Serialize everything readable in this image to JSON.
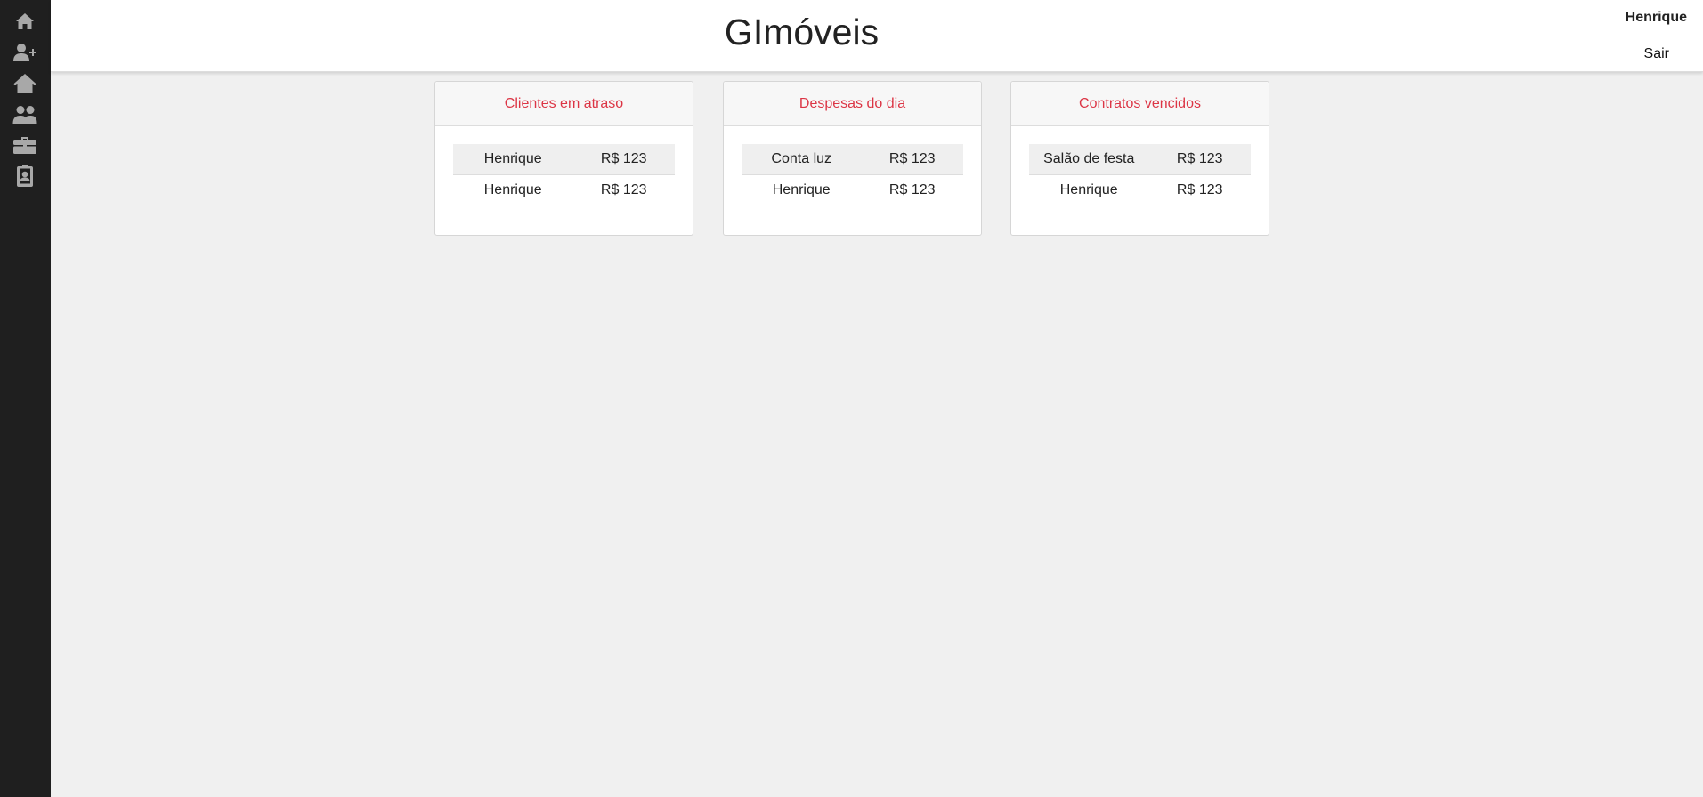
{
  "header": {
    "title": "GImóveis",
    "user": "Henrique",
    "logout_label": "Sair"
  },
  "sidebar": {
    "items": [
      {
        "icon": "home-icon"
      },
      {
        "icon": "add-user-icon"
      },
      {
        "icon": "property-icon"
      },
      {
        "icon": "users-icon"
      },
      {
        "icon": "briefcase-icon"
      },
      {
        "icon": "contact-badge-icon"
      }
    ]
  },
  "cards": [
    {
      "title": "Clientes em atraso",
      "rows": [
        {
          "name": "Henrique",
          "value": "R$ 123"
        },
        {
          "name": "Henrique",
          "value": "R$ 123"
        }
      ]
    },
    {
      "title": "Despesas do dia",
      "rows": [
        {
          "name": "Conta luz",
          "value": "R$ 123"
        },
        {
          "name": "Henrique",
          "value": "R$ 123"
        }
      ]
    },
    {
      "title": "Contratos vencidos",
      "rows": [
        {
          "name": "Salão de festa",
          "value": "R$ 123"
        },
        {
          "name": "Henrique",
          "value": "R$ 123"
        }
      ]
    }
  ],
  "colors": {
    "sidebar_bg": "#1f1f1f",
    "icon": "#a8a8a8",
    "accent": "#dc3545",
    "page_bg": "#f0f0f0"
  }
}
